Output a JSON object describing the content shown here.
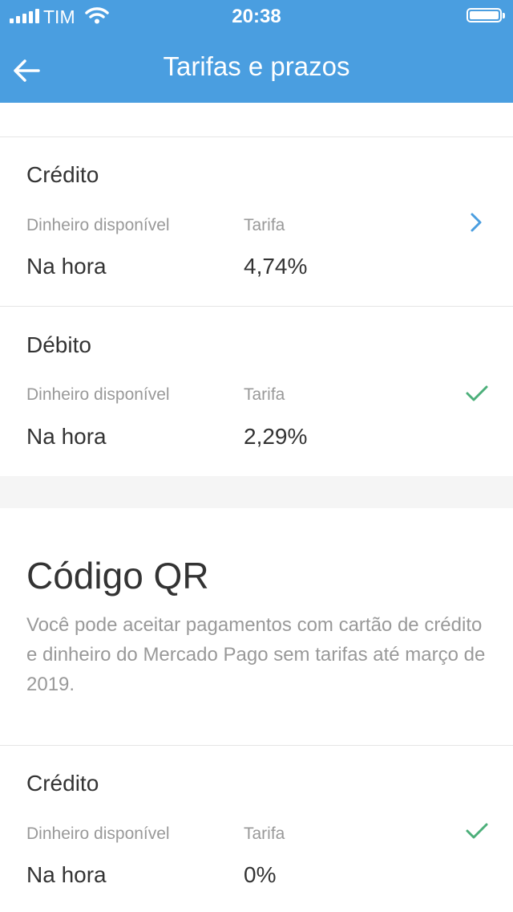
{
  "status_bar": {
    "carrier": "TIM",
    "time": "20:38"
  },
  "header": {
    "title": "Tarifas e prazos"
  },
  "sections": [
    {
      "title": "Crédito",
      "label_left": "Dinheiro disponível",
      "label_right": "Tarifa",
      "value_left": "Na hora",
      "value_right": "4,74%",
      "icon": "chevron-right-icon"
    },
    {
      "title": "Débito",
      "label_left": "Dinheiro disponível",
      "label_right": "Tarifa",
      "value_left": "Na hora",
      "value_right": "2,29%",
      "icon": "check-icon"
    }
  ],
  "qr": {
    "title": "Código QR",
    "description": "Você pode aceitar pagamentos com cartão de crédito e dinheiro do Mercado Pago sem tarifas até março de 2019.",
    "section": {
      "title": "Crédito",
      "label_left": "Dinheiro disponível",
      "label_right": "Tarifa",
      "value_left": "Na hora",
      "value_right": "0%",
      "icon": "check-icon"
    }
  },
  "colors": {
    "header": "#4a9ee0",
    "accent_blue": "#4a9ee0",
    "check_green": "#4caf7a"
  }
}
